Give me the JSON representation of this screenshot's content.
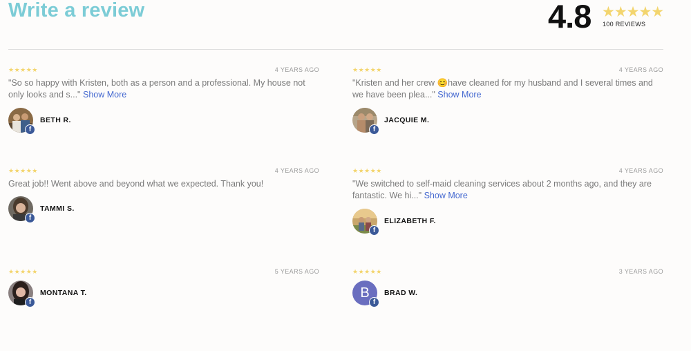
{
  "header": {
    "write_review": "Write a review",
    "rating": "4.8",
    "stars": "★★★★★",
    "review_count": "100 REVIEWS"
  },
  "reviews": [
    {
      "stars": "★★★★★",
      "date": "4 YEARS AGO",
      "text": "\"So so happy with Kristen, both as a person and a professional. My house not only looks and s...\"",
      "show_more": "Show More",
      "author": "BETH R.",
      "source": "facebook-icon"
    },
    {
      "stars": "★★★★★",
      "date": "4 YEARS AGO",
      "text": "\"Kristen and her crew 😊have cleaned for my husband and I several times and we have been plea...\"",
      "show_more": "Show More",
      "author": "JACQUIE M.",
      "source": "facebook-icon"
    },
    {
      "stars": "★★★★★",
      "date": "4 YEARS AGO",
      "text": "Great job!! Went above and beyond what we expected. Thank you!",
      "show_more": "",
      "author": "TAMMI S.",
      "source": "facebook-icon"
    },
    {
      "stars": "★★★★★",
      "date": "4 YEARS AGO",
      "text": "\"We switched to self-maid cleaning services about 2 months ago, and they are fantastic. We hi...\"",
      "show_more": "Show More",
      "author": "ELIZABETH F.",
      "source": "facebook-icon"
    },
    {
      "stars": "★★★★★",
      "date": "5 YEARS AGO",
      "text": "",
      "show_more": "",
      "author": "MONTANA T.",
      "source": "facebook-icon"
    },
    {
      "stars": "★★★★★",
      "date": "3 YEARS AGO",
      "text": "",
      "show_more": "",
      "author": "BRAD W.",
      "initial": "B",
      "source": "facebook-icon"
    }
  ],
  "colors": {
    "accent": "#7cccd6",
    "star": "#f3d56e",
    "link": "#4468d0",
    "facebook": "#3b5998",
    "initial_avatar": "#6a6ebf"
  }
}
